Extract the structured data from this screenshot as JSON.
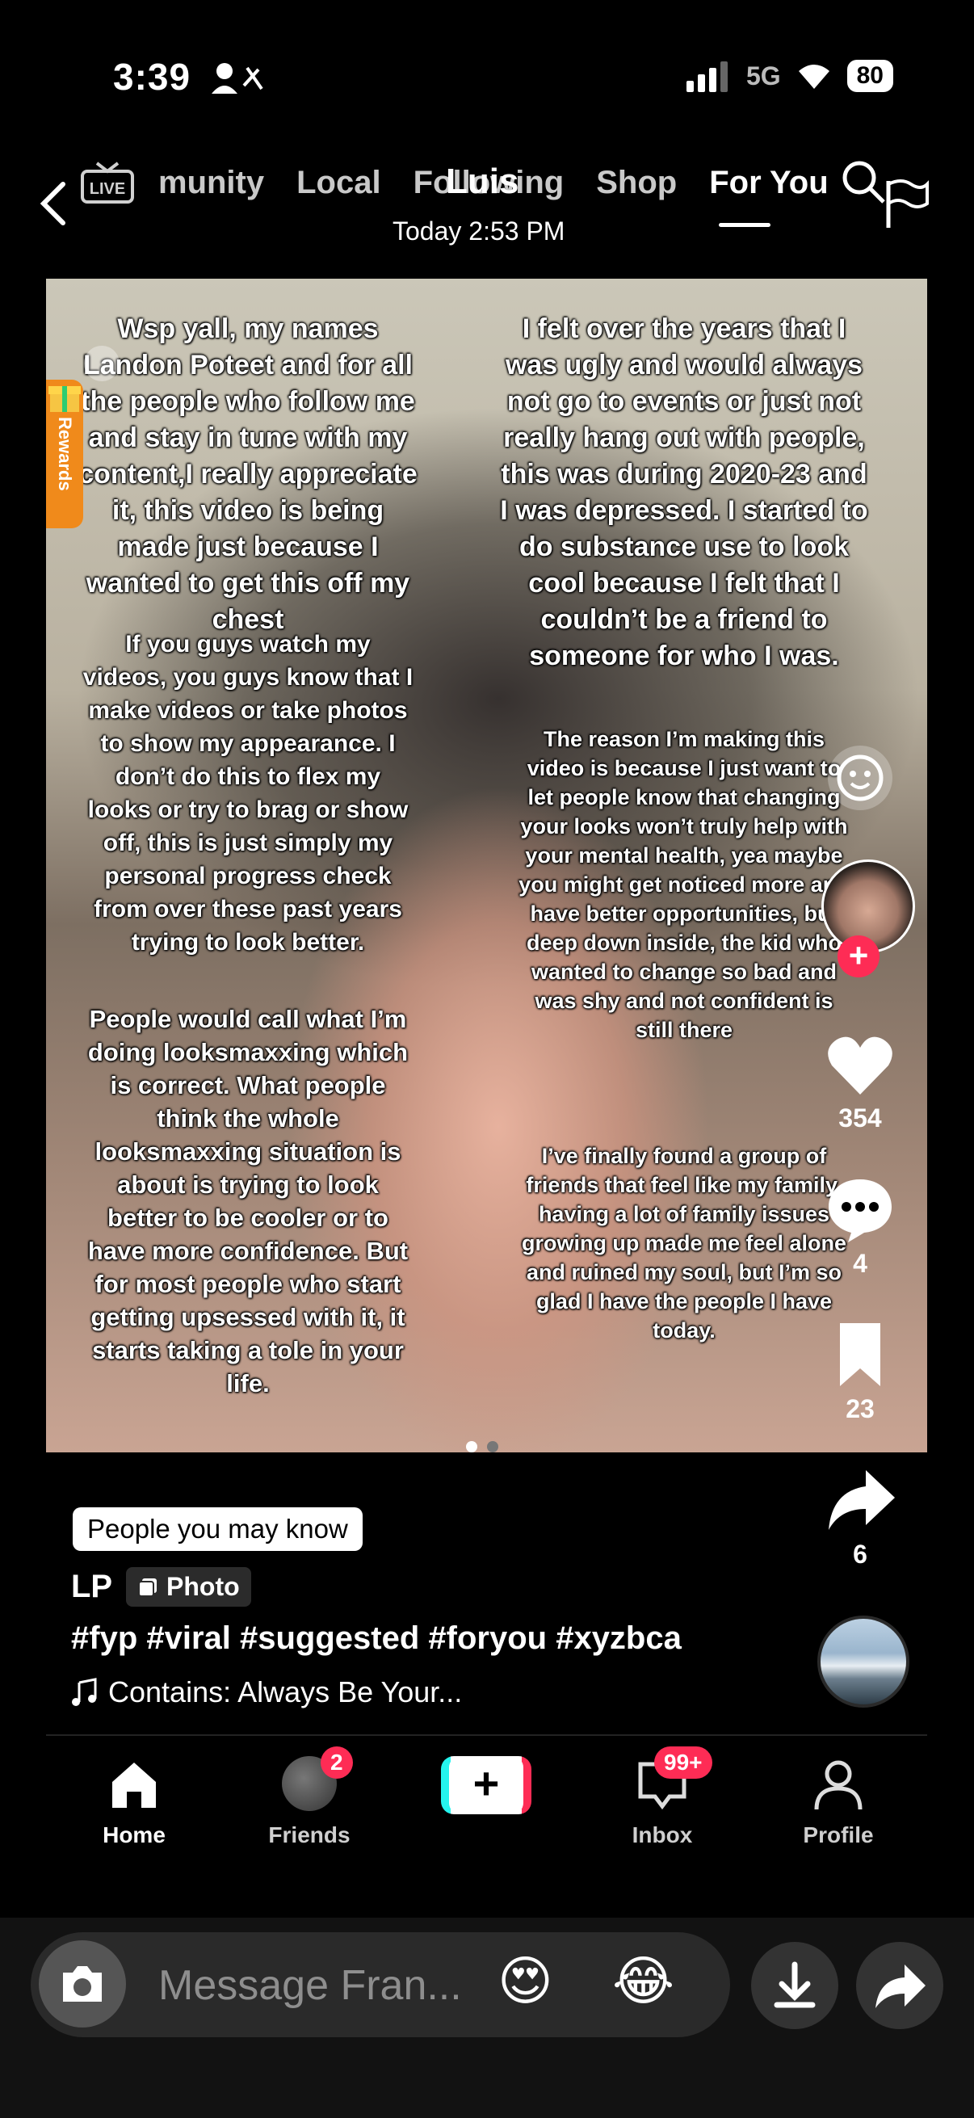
{
  "status_bar": {
    "time": "3:39",
    "network": "5G",
    "battery": "80"
  },
  "top_nav": {
    "tabs": [
      "munity",
      "Local",
      "Following",
      "Shop",
      "For You"
    ],
    "active_tab": "For You",
    "overlay_name": "Luis",
    "overlay_time": "Today 2:53 PM"
  },
  "photo_text": {
    "left_1": "Wsp yall, my names Landon Poteet and for all the people who follow me and stay in tune with my content,I really appreciate it, this video is being made just because I wanted to get this off my chest",
    "left_2": "If you guys watch my videos, you guys know that I make videos or take photos to show my appearance. I don’t do this to flex my looks or try to brag or show off, this is just simply my personal progress check from over these past years trying to look better.",
    "left_3": "People would call what I’m doing looksmaxxing which is correct. What people think the whole looksmaxxing situation is about is trying to look better to be cooler or to have more confidence. But for most people who start getting upsessed with it, it starts taking a tole in your life.",
    "right_1": "I felt over the years that I was ugly and would always not go to events or just not really hang out with people, this was during 2020-23 and I was depressed. I started to do substance use to look cool because I felt that I couldn’t be a friend to someone for who I was.",
    "right_2": "The reason I’m making this video is because I just want to let people know that changing your looks won’t truly help with your mental health, yea maybe you might get noticed more and have better opportunities, but deep down inside, the kid who wanted to change so bad and was shy and not confident is still there",
    "right_3": "I’ve finally found a group of friends that feel like my family, having a lot of family issues growing up made me feel alone and ruined my soul, but I’m so glad I have the people I have today.",
    "rewards": "Rewards"
  },
  "carousel": {
    "current": 1,
    "total": 2
  },
  "actions": {
    "likes": "354",
    "comments": "4",
    "saves": "23",
    "shares": "6"
  },
  "post": {
    "people_you_may_know": "People you may know",
    "author": "LP",
    "type_badge": "Photo",
    "hashtags": "#fyp #viral #suggested #foryou #xyzbca",
    "music": "Contains: Always Be Your..."
  },
  "bottom_nav": {
    "home": "Home",
    "friends": "Friends",
    "friends_badge": "2",
    "inbox": "Inbox",
    "inbox_badge": "99+",
    "profile": "Profile"
  },
  "message_bar": {
    "placeholder": "Message Fran...",
    "emoji_1": "😍",
    "emoji_2": "😂"
  },
  "colors": {
    "accent_red": "#fe2c55",
    "accent_cyan": "#25f4ee",
    "background": "#000000"
  }
}
